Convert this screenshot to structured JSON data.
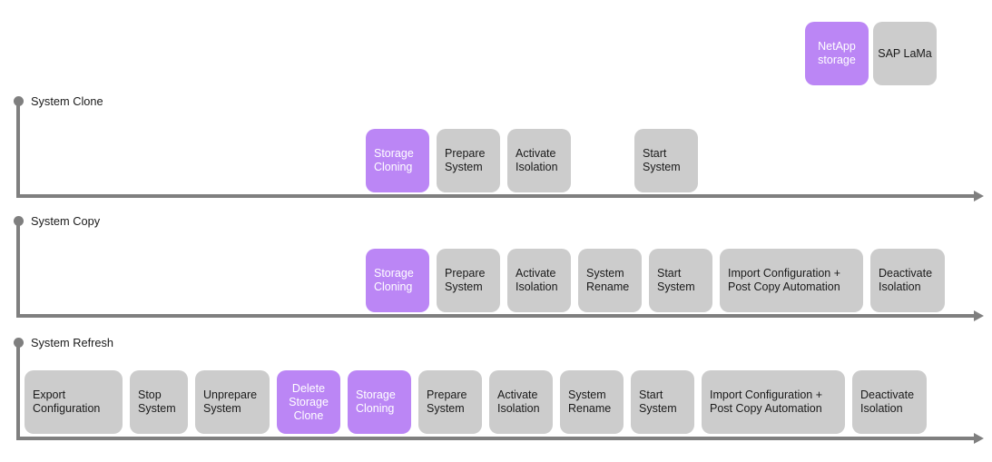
{
  "legend": {
    "items": [
      {
        "label": "NetApp\nstorage",
        "color": "#bb86f5",
        "style": "purple"
      },
      {
        "label": "SAP\nLaMa",
        "color": "#cccccc",
        "style": "gray"
      }
    ]
  },
  "rows": [
    {
      "id": "system-clone",
      "label": "System Clone",
      "axis_end_label": "",
      "steps": [
        {
          "label": "Storage\nCloning",
          "style": "purple"
        },
        {
          "label": "Prepare\nSystem",
          "style": "gray"
        },
        {
          "label": "Activate\nIsolation",
          "style": "gray"
        },
        {
          "label": "Start\nSystem",
          "style": "gray"
        }
      ]
    },
    {
      "id": "system-copy",
      "label": "System Copy",
      "axis_end_label": "",
      "steps": [
        {
          "label": "Storage\nCloning",
          "style": "purple"
        },
        {
          "label": "Prepare\nSystem",
          "style": "gray"
        },
        {
          "label": "Activate\nIsolation",
          "style": "gray"
        },
        {
          "label": "System\nRename",
          "style": "gray"
        },
        {
          "label": "Start\nSystem",
          "style": "gray"
        },
        {
          "label": "Import Configuration +\nPost Copy Automation",
          "style": "gray"
        },
        {
          "label": "Deactivate\nIsolation",
          "style": "gray"
        }
      ]
    },
    {
      "id": "system-refresh",
      "label": "System Refresh",
      "axis_end_label": "",
      "steps": [
        {
          "label": "Export\nConfiguration",
          "style": "gray"
        },
        {
          "label": "Stop\nSystem",
          "style": "gray"
        },
        {
          "label": "Unprepare\nSystem",
          "style": "gray"
        },
        {
          "label": "Delete\nStorage\nClone",
          "style": "purple"
        },
        {
          "label": "Storage\nCloning",
          "style": "purple"
        },
        {
          "label": "Prepare\nSystem",
          "style": "gray"
        },
        {
          "label": "Activate\nIsolation",
          "style": "gray"
        },
        {
          "label": "System\nRename",
          "style": "gray"
        },
        {
          "label": "Start\nSystem",
          "style": "gray"
        },
        {
          "label": "Import Configuration +\nPost Copy Automation",
          "style": "gray"
        },
        {
          "label": "Deactivate\nIsolation",
          "style": "gray"
        }
      ]
    }
  ],
  "colors": {
    "netapp_purple": "#bb86f5",
    "lama_gray": "#cccccc",
    "axis_gray": "#7f7f7f",
    "text_dark": "#1a1a1a",
    "text_light": "#ffffff"
  }
}
